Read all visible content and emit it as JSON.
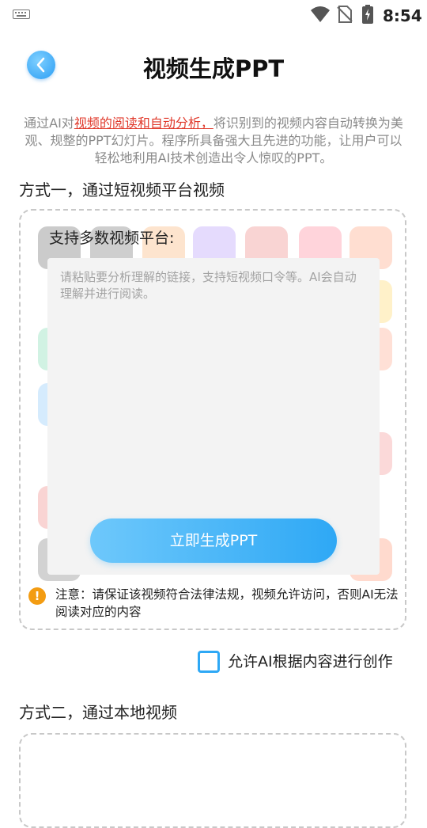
{
  "status_bar": {
    "time": "8:54",
    "icons": [
      "keyboard-icon",
      "wifi-icon",
      "no-sim-icon",
      "battery-charging-icon"
    ]
  },
  "header": {
    "title": "视频生成PPT",
    "back_icon": "chevron-left-icon"
  },
  "intro": {
    "prefix": "通过AI对",
    "highlight": "视频的阅读和自动分析，",
    "suffix": "将识别到的视频内容自动转换为美观、规整的PPT幻灯片。程序所具备强大且先进的功能，让用户可以轻松地利用AI技术创造出令人惊叹的PPT。",
    "highlight_color": "#e0392b"
  },
  "method1": {
    "title": "方式一，通过短视频平台视频",
    "platforms_label": "支持多数视频平台:",
    "input_placeholder": "请粘贴要分析理解的链接，支持短视频口令等。AI会自动理解并进行阅读。",
    "generate_button": "立即生成PPT",
    "notice": "注意：请保证该视频符合法律法规，视频允许访问，否则AI无法阅读对应的内容"
  },
  "allow_creation": {
    "label": "允许AI根据内容进行创作",
    "checked": false
  },
  "method2": {
    "title": "方式二，通过本地视频"
  },
  "colors": {
    "accent": "#2ea8f5",
    "warning": "#f39c12",
    "highlight": "#e0392b"
  }
}
